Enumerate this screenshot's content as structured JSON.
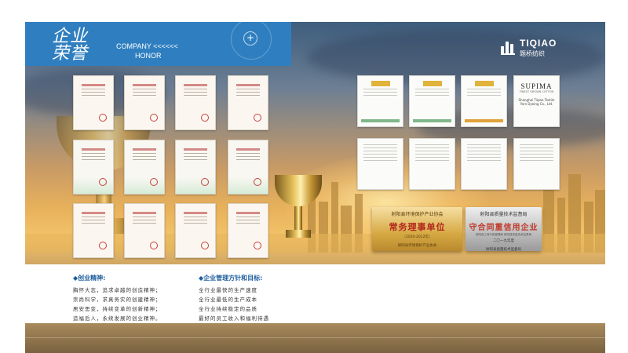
{
  "header": {
    "title_cn": "企业荣誉",
    "title_en_line1": "COMPANY <<<<<<",
    "title_en_line2": "HONOR",
    "plus_glyph": "+"
  },
  "logo": {
    "icon": "tiqiao-logo-icon",
    "brand_en": "TIQIAO",
    "brand_cn": "题桥纺织"
  },
  "patent_certificates": {
    "rows": 3,
    "cols": 4,
    "count": 12,
    "style": "patent certificate with red seal"
  },
  "test_reports": {
    "row1_badges": [
      "",
      "",
      ""
    ],
    "row1_titles": [
      "",
      "",
      ""
    ],
    "supima": {
      "title": "SUPIMA",
      "subtitle": "FINEST GROWN COTTON",
      "company": "Shanghai Tiqiao Textile Yarn Dyeing Co., Ltd."
    },
    "row2_count": 4
  },
  "plaques": [
    {
      "top": "射阳县环境保护产业协会",
      "main": "常务理事单位",
      "year": "（2020-2022年）",
      "foot": "射阳县环境保护产业协会"
    },
    {
      "top": "射阳县质量技术监督局",
      "main": "守合同重信用企业",
      "sub": "射阳县工商行政管理局 射阳县质量技术监督局",
      "year": "二〇一九年度",
      "foot": "射阳县质量技术监督局"
    }
  ],
  "sections": {
    "spirit": {
      "title": "◆创业精神:",
      "text": "胸怀大志，追求卓越的创造精神；\n崇尚科学，求真务实的创建精神；\n居安思变，持续变革的创新精神；\n造福后人，永续发展的创业精神。"
    },
    "policy": {
      "title": "◆企业管理方针和目标:",
      "text": "全行业最快的生产速度\n全行业最低的生产成本\n全行业持续稳定的品质\n最好的员工收入和福利待遇"
    }
  },
  "colors": {
    "header_blue": "#2f7fc0",
    "section_title_blue": "#1f5e9c",
    "plaque_red": "#b3261e"
  }
}
